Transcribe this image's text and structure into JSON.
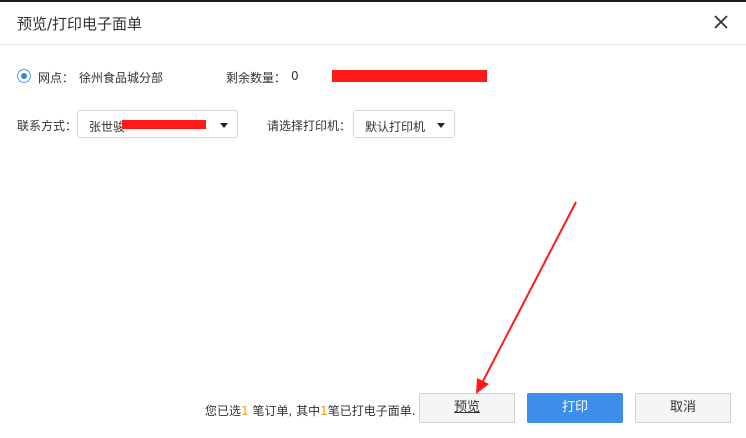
{
  "dialog": {
    "title": "预览/打印电子面单",
    "close_icon": "close-icon"
  },
  "site": {
    "label": "网点：",
    "value": "徐州食品城分部",
    "remaining_label": "剩余数量：",
    "remaining_value": "0"
  },
  "contact": {
    "label": "联系方式：",
    "selected": "张世骏"
  },
  "printer": {
    "label": "请选择打印机：",
    "selected": "默认打印机"
  },
  "footer": {
    "text_a": "您已选",
    "selected_count": "1",
    "text_b": " 笔订单, 其中",
    "printed_count": "1",
    "text_c": "笔已打电子面单."
  },
  "buttons": {
    "preview": "预览",
    "print": "打印",
    "cancel": "取消"
  },
  "colors": {
    "primary": "#3d8ee8",
    "highlight_number": "#f39c12",
    "annotation_red": "#ff1a1a"
  }
}
